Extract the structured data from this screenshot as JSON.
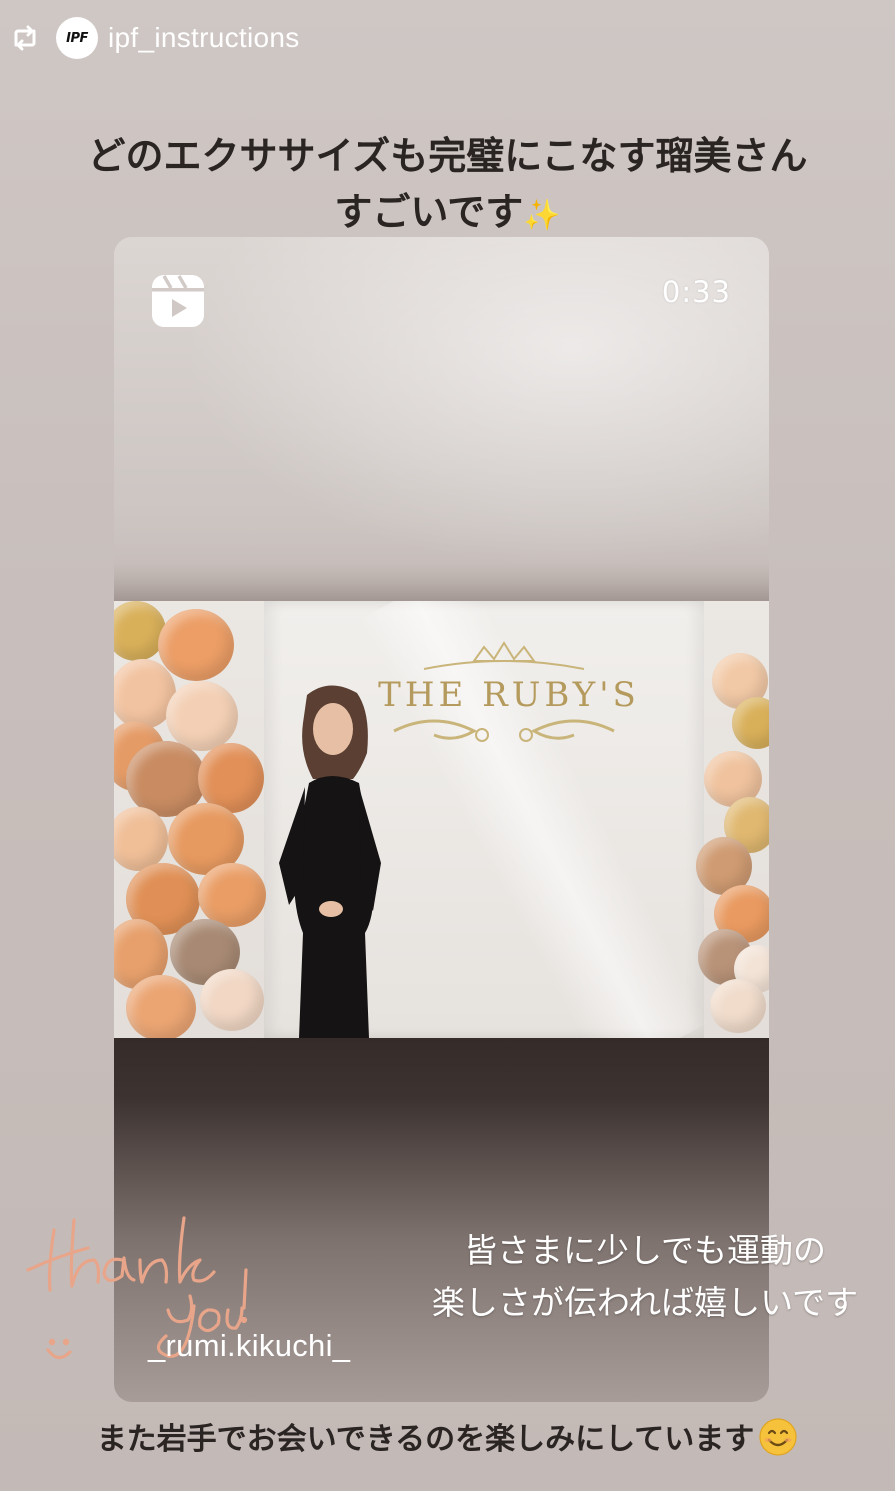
{
  "repost": {
    "icon": "repost-icon",
    "avatar_logo": "IPF",
    "username": "ipf_instructions"
  },
  "caption_top": {
    "line1": "どのエクササイズも完璧にこなす瑠美さん",
    "line2": "すごいです",
    "emoji": "✨"
  },
  "reel": {
    "icon": "reel-icon",
    "duration": "0:33",
    "sign_text": "THE RUBY'S",
    "overlay_line1": "皆さまに少しでも運動の",
    "overlay_line2": "楽しさが伝われば嬉しいです",
    "mention": "_rumi.kikuchi_",
    "signature_word1": "thank",
    "signature_word2": "you!"
  },
  "caption_bottom": {
    "text": "また岩手でお会いできるのを楽しみにしています",
    "emoji": "smiling-face-emoji"
  },
  "colors": {
    "background": "#c8bfbc",
    "caption_text": "#2a2423",
    "signature": "#e8a58a",
    "sign_gold": "#b49a5c",
    "balloon_orange": "#e39a62",
    "balloon_peach": "#f0c4a2",
    "balloon_gold": "#d9b05a"
  }
}
